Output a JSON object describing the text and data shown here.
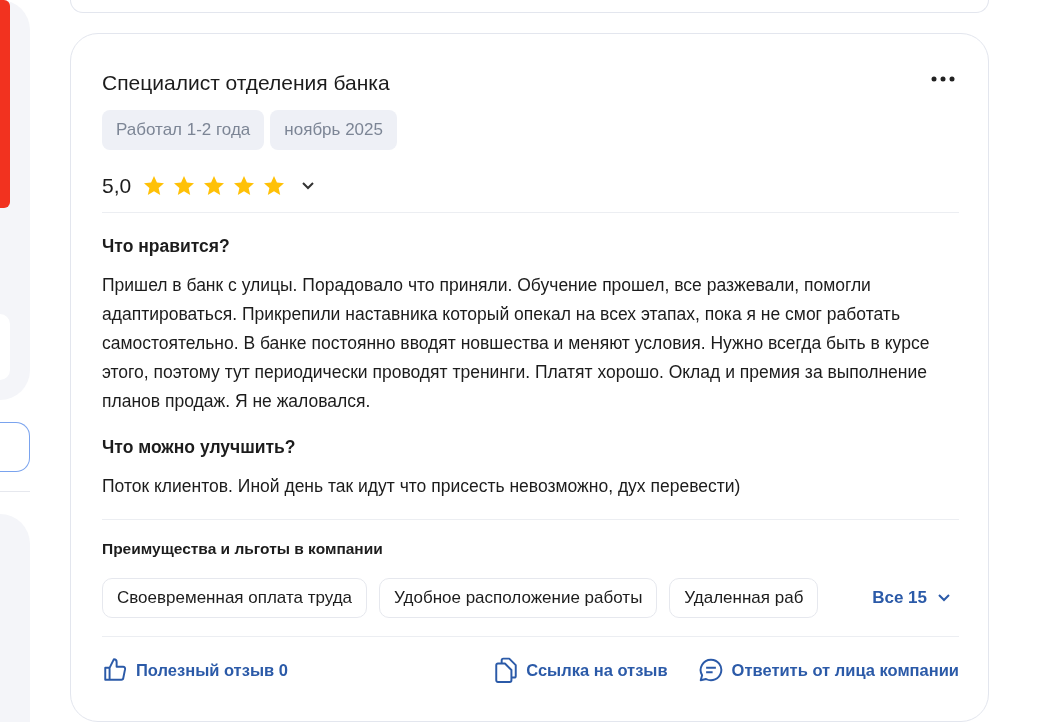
{
  "review": {
    "title": "Специалист отделения банка",
    "tags": [
      "Работал 1-2 года",
      "ноябрь 2025"
    ],
    "rating": "5,0",
    "stars": 5,
    "sections": [
      {
        "heading": "Что нравится?",
        "text": "Пришел в банк с улицы. Порадовало что приняли. Обучение прошел, все разжевали, помогли адаптироваться. Прикрепили наставника который опекал на всех этапах, пока я не смог работать самостоятельно. В банке постоянно вводят новшества и меняют условия. Нужно всегда быть в курсе этого, поэтому тут периодически проводят тренинги. Платят хорошо. Оклад и премия за выполнение планов продаж. Я не жаловался."
      },
      {
        "heading": "Что можно улучшить?",
        "text": "Поток клиентов. Иной день так идут что присесть невозможно, дух перевести)"
      }
    ],
    "benefits_title": "Преимущества и льготы в компании",
    "benefits": [
      "Своевременная оплата труда",
      "Удобное расположение работы",
      "Удаленная раб"
    ],
    "benefits_more": "Все 15",
    "actions": [
      {
        "kind": "like",
        "label": "Полезный отзыв 0"
      },
      {
        "kind": "link",
        "label": "Ссылка на отзыв"
      },
      {
        "kind": "reply",
        "label": "Ответить от лица компании"
      }
    ]
  }
}
